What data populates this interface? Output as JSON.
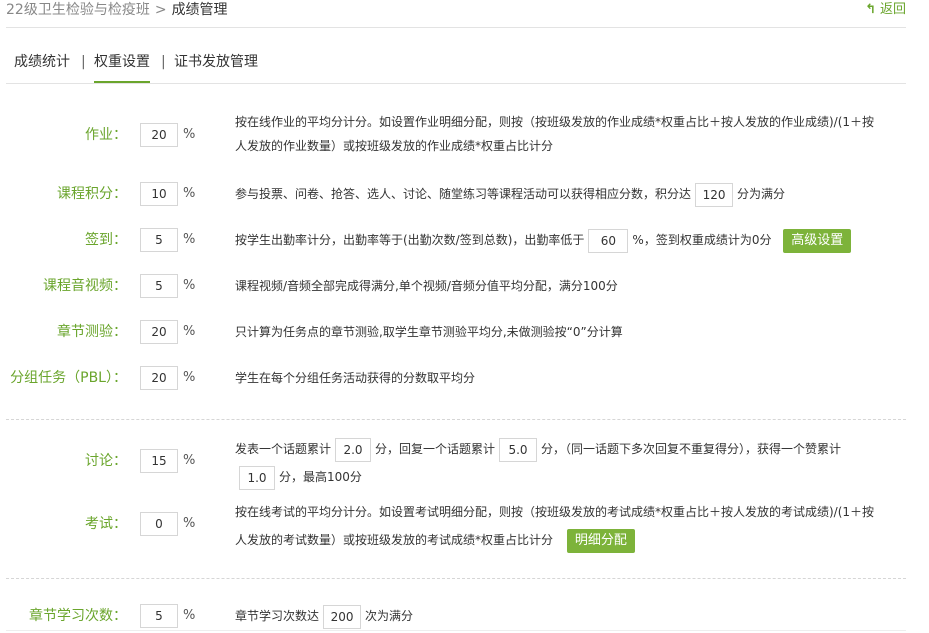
{
  "breadcrumb": {
    "course": "22级卫生检验与检疫班",
    "separator": ">",
    "current": "成绩管理"
  },
  "back": {
    "icon": "back-arrow-icon",
    "label": "返回"
  },
  "tabs": [
    "成绩统计",
    "权重设置",
    "证书发放管理"
  ],
  "tab_separator": "|",
  "active_tab": "权重设置",
  "percent_sign": "%",
  "items": {
    "homework": {
      "label": "作业：",
      "value": "20",
      "desc_line1": "按在线作业的平均分计分。如设置作业明细分配，则按（按班级发放的作业成绩*权重占比＋按人发放的作业成绩)/(1＋按",
      "desc_line2": "人发放的作业数量）或按班级发放的作业成绩*权重占比计分"
    },
    "course_points": {
      "label": "课程积分：",
      "value": "10",
      "desc_pre": "参与投票、问卷、抢答、选人、讨论、随堂练习等课程活动可以获得相应分数，积分达",
      "full_value": "120",
      "desc_post": "分为满分"
    },
    "signin": {
      "label": "签到：",
      "value": "5",
      "desc_pre": "按学生出勤率计分，出勤率等于(出勤次数/签到总数)，出勤率低于",
      "threshold": "60",
      "desc_post": "%，签到权重成绩计为0分",
      "button": "高级设置"
    },
    "video": {
      "label": "课程音视频：",
      "value": "5",
      "desc": "课程视频/音频全部完成得满分,单个视频/音频分值平均分配，满分100分"
    },
    "chapter_quiz": {
      "label": "章节测验：",
      "value": "20",
      "desc": "只计算为任务点的章节测验,取学生章节测验平均分,未做测验按“0”分计算"
    },
    "group_task": {
      "label": "分组任务（PBL）：",
      "value": "20",
      "desc": "学生在每个分组任务活动获得的分数取平均分"
    },
    "discussion": {
      "label": "讨论：",
      "value": "15",
      "t1": "发表一个话题累计",
      "v1": "2.0",
      "t2": "分，回复一个话题累计",
      "v2": "5.0",
      "t3": "分，（同一话题下多次回复不重复得分），获得一个赞累计",
      "v3": "1.0",
      "t4": "分，最高100分"
    },
    "exam": {
      "label": "考试：",
      "value": "0",
      "desc_line1": "按在线考试的平均分计分。如设置考试明细分配，则按（按班级发放的考试成绩*权重占比＋按人发放的考试成绩)/(1＋按",
      "desc_line2": "人发放的考试数量）或按班级发放的考试成绩*权重占比计分",
      "button": "明细分配"
    },
    "chapter_study": {
      "label": "章节学习次数：",
      "value": "5",
      "desc_pre": "章节学习次数达",
      "count": "200",
      "desc_post": "次为满分"
    }
  }
}
